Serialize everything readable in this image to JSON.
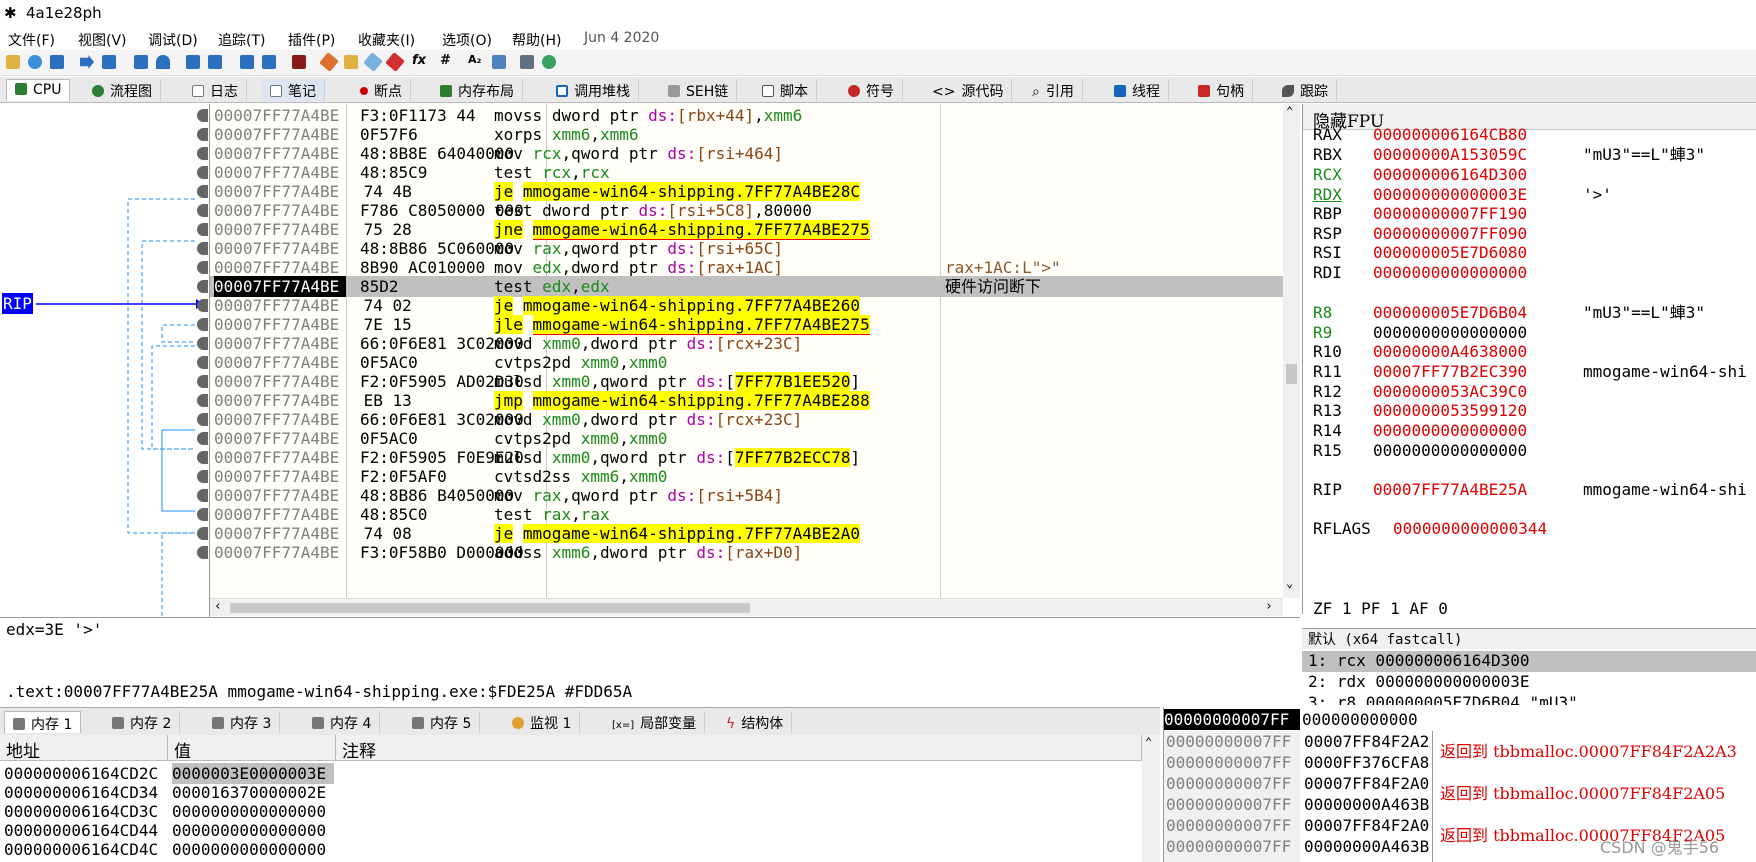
{
  "window": {
    "title": "4a1e28ph"
  },
  "menu": [
    {
      "label": "文件(F)"
    },
    {
      "label": "视图(V)"
    },
    {
      "label": "调试(D)"
    },
    {
      "label": "追踪(T)"
    },
    {
      "label": "插件(P)"
    },
    {
      "label": "收藏夹(I)"
    },
    {
      "label": "选项(O)"
    },
    {
      "label": "帮助(H)"
    },
    {
      "label": "Jun 4 2020"
    }
  ],
  "toolbar": {
    "fx": "fx",
    "hash": "#",
    "az": "A₂"
  },
  "tabs": [
    {
      "label": "CPU",
      "icon": "cpu-icon",
      "color": "#2e7d32"
    },
    {
      "label": "流程图",
      "icon": "graph-icon",
      "color": "#2e7d32"
    },
    {
      "label": "日志",
      "icon": "log-icon",
      "color": "#777777"
    },
    {
      "label": "笔记",
      "icon": "notes-icon",
      "color": "#777777"
    },
    {
      "label": "断点",
      "icon": "breakpoint-icon",
      "color": "#d00000"
    },
    {
      "label": "内存布局",
      "icon": "memory-map-icon",
      "color": "#2e7d32"
    },
    {
      "label": "调用堆栈",
      "icon": "call-stack-icon",
      "color": "#1565c0"
    },
    {
      "label": "SEH链",
      "icon": "seh-icon",
      "color": "#555555"
    },
    {
      "label": "脚本",
      "icon": "script-icon",
      "color": "#555555"
    },
    {
      "label": "符号",
      "icon": "symbols-icon",
      "color": "#c62828"
    },
    {
      "label": "源代码",
      "icon": "source-icon",
      "color": "#555555"
    },
    {
      "label": "引用",
      "icon": "references-icon",
      "color": "#555555"
    },
    {
      "label": "线程",
      "icon": "threads-icon",
      "color": "#1565c0"
    },
    {
      "label": "句柄",
      "icon": "handles-icon",
      "color": "#c62828"
    },
    {
      "label": "跟踪",
      "icon": "trace-icon",
      "color": "#555555"
    }
  ],
  "disasm": {
    "rip_label": "RIP",
    "rows": [
      {
        "addr": "00007FF77A4BE",
        "bytes": "F3:0F1173 44",
        "mn": "movss",
        "ops": [
          [
            "dword ptr ",
            ""
          ],
          [
            "ds:",
            "kw"
          ],
          [
            "[rbx+44]",
            "num"
          ],
          [
            ",",
            ""
          ],
          [
            "xmm6",
            "reg"
          ]
        ],
        "jump": false,
        "ul": false,
        "arrow": "",
        "comment": "",
        "rip": false
      },
      {
        "addr": "00007FF77A4BE",
        "bytes": "0F57F6",
        "mn": "xorps",
        "ops": [
          [
            "xmm6",
            "reg"
          ],
          [
            ",",
            ""
          ],
          [
            "xmm6",
            "reg"
          ]
        ],
        "jump": false,
        "ul": false,
        "arrow": "",
        "comment": "",
        "rip": false
      },
      {
        "addr": "00007FF77A4BE",
        "bytes": "48:8B8E 64040000",
        "mn": "mov",
        "ops": [
          [
            "rcx",
            "reg"
          ],
          [
            ",qword ptr ",
            ""
          ],
          [
            "ds:",
            "kw"
          ],
          [
            "[rsi+464]",
            "num"
          ]
        ],
        "jump": false,
        "ul": false,
        "arrow": "",
        "comment": "",
        "rip": false
      },
      {
        "addr": "00007FF77A4BE",
        "bytes": "48:85C9",
        "mn": "test",
        "ops": [
          [
            "rcx",
            "reg"
          ],
          [
            ",",
            ""
          ],
          [
            "rcx",
            "reg"
          ]
        ],
        "jump": false,
        "ul": false,
        "arrow": "",
        "comment": "",
        "rip": false
      },
      {
        "addr": "00007FF77A4BE",
        "bytes": "74 4B",
        "mn": "je",
        "ops": [
          [
            "mmogame-win64-shipping.7FF77A4BE28C",
            ""
          ]
        ],
        "jump": true,
        "ul": false,
        "arrow": "⌄",
        "comment": "",
        "rip": false
      },
      {
        "addr": "00007FF77A4BE",
        "bytes": "F786 C8050000 000",
        "mn": "test",
        "ops": [
          [
            "dword ptr ",
            ""
          ],
          [
            "ds:",
            "kw"
          ],
          [
            "[rsi+5C8]",
            "num"
          ],
          [
            ",80000",
            ""
          ]
        ],
        "jump": false,
        "ul": false,
        "arrow": "",
        "comment": "",
        "rip": false
      },
      {
        "addr": "00007FF77A4BE",
        "bytes": "75 28",
        "mn": "jne",
        "ops": [
          [
            "mmogame-win64-shipping.7FF77A4BE275",
            ""
          ]
        ],
        "jump": true,
        "ul": true,
        "arrow": "⌄",
        "comment": "",
        "rip": false
      },
      {
        "addr": "00007FF77A4BE",
        "bytes": "48:8B86 5C060000",
        "mn": "mov",
        "ops": [
          [
            "rax",
            "reg"
          ],
          [
            ",qword ptr ",
            ""
          ],
          [
            "ds:",
            "kw"
          ],
          [
            "[rsi+65C]",
            "num"
          ]
        ],
        "jump": false,
        "ul": false,
        "arrow": "",
        "comment": "",
        "rip": false
      },
      {
        "addr": "00007FF77A4BE",
        "bytes": "8B90 AC010000",
        "mn": "mov",
        "ops": [
          [
            "edx",
            "reg"
          ],
          [
            ",dword ptr ",
            ""
          ],
          [
            "ds:",
            "kw"
          ],
          [
            "[rax+1AC]",
            "num"
          ]
        ],
        "jump": false,
        "ul": false,
        "arrow": "",
        "comment": "rax+1AC:L\">\"",
        "rip": false
      },
      {
        "addr": "00007FF77A4BE",
        "bytes": "85D2",
        "mn": "test",
        "ops": [
          [
            "edx",
            "reg"
          ],
          [
            ",",
            ""
          ],
          [
            "edx",
            "reg"
          ]
        ],
        "jump": false,
        "ul": false,
        "arrow": "",
        "comment": "硬件访问断下",
        "rip": true
      },
      {
        "addr": "00007FF77A4BE",
        "bytes": "74 02",
        "mn": "je",
        "ops": [
          [
            "mmogame-win64-shipping.7FF77A4BE260",
            ""
          ]
        ],
        "jump": true,
        "ul": false,
        "arrow": "⌄",
        "comment": "",
        "rip": false
      },
      {
        "addr": "00007FF77A4BE",
        "bytes": "7E 15",
        "mn": "jle",
        "ops": [
          [
            "mmogame-win64-shipping.7FF77A4BE275",
            ""
          ]
        ],
        "jump": true,
        "ul": true,
        "arrow": "⌄",
        "comment": "",
        "rip": false
      },
      {
        "addr": "00007FF77A4BE",
        "bytes": "66:0F6E81 3C02000",
        "mn": "movd",
        "ops": [
          [
            "xmm0",
            "reg"
          ],
          [
            ",dword ptr ",
            ""
          ],
          [
            "ds:",
            "kw"
          ],
          [
            "[rcx+23C]",
            "num"
          ]
        ],
        "jump": false,
        "ul": false,
        "arrow": "",
        "comment": "",
        "rip": false
      },
      {
        "addr": "00007FF77A4BE",
        "bytes": "0F5AC0",
        "mn": "cvtps2pd",
        "ops": [
          [
            "xmm0",
            "reg"
          ],
          [
            ",",
            ""
          ],
          [
            "xmm0",
            "reg"
          ]
        ],
        "jump": false,
        "ul": false,
        "arrow": "",
        "comment": "",
        "rip": false
      },
      {
        "addr": "00007FF77A4BE",
        "bytes": "F2:0F5905 AD02D30",
        "mn": "mulsd",
        "ops": [
          [
            "xmm0",
            "reg"
          ],
          [
            ",qword ptr ",
            ""
          ],
          [
            "ds:",
            "kw"
          ],
          [
            "[",
            ""
          ],
          [
            "7FF77B1EE520",
            "jmpinline"
          ],
          [
            "]",
            ""
          ]
        ],
        "jump": false,
        "ul": false,
        "arrow": "",
        "comment": "",
        "rip": false
      },
      {
        "addr": "00007FF77A4BE",
        "bytes": "EB 13",
        "mn": "jmp",
        "ops": [
          [
            "mmogame-win64-shipping.7FF77A4BE288",
            ""
          ]
        ],
        "jump": true,
        "ul": false,
        "arrow": "⌄",
        "comment": "",
        "rip": false
      },
      {
        "addr": "00007FF77A4BE",
        "bytes": "66:0F6E81 3C02000",
        "mn": "movd",
        "ops": [
          [
            "xmm0",
            "reg"
          ],
          [
            ",dword ptr ",
            ""
          ],
          [
            "ds:",
            "kw"
          ],
          [
            "[rcx+23C]",
            "num"
          ]
        ],
        "jump": false,
        "ul": false,
        "arrow": "",
        "comment": "",
        "rip": false
      },
      {
        "addr": "00007FF77A4BE",
        "bytes": "0F5AC0",
        "mn": "cvtps2pd",
        "ops": [
          [
            "xmm0",
            "reg"
          ],
          [
            ",",
            ""
          ],
          [
            "xmm0",
            "reg"
          ]
        ],
        "jump": false,
        "ul": false,
        "arrow": "",
        "comment": "",
        "rip": false
      },
      {
        "addr": "00007FF77A4BE",
        "bytes": "F2:0F5905 F0E9E20",
        "mn": "mulsd",
        "ops": [
          [
            "xmm0",
            "reg"
          ],
          [
            ",qword ptr ",
            ""
          ],
          [
            "ds:",
            "kw"
          ],
          [
            "[",
            ""
          ],
          [
            "7FF77B2ECC78",
            "jmpinline"
          ],
          [
            "]",
            ""
          ]
        ],
        "jump": false,
        "ul": false,
        "arrow": "",
        "comment": "",
        "rip": false
      },
      {
        "addr": "00007FF77A4BE",
        "bytes": "F2:0F5AF0",
        "mn": "cvtsd2ss",
        "ops": [
          [
            "xmm6",
            "reg"
          ],
          [
            ",",
            ""
          ],
          [
            "xmm0",
            "reg"
          ]
        ],
        "jump": false,
        "ul": false,
        "arrow": "",
        "comment": "",
        "rip": false
      },
      {
        "addr": "00007FF77A4BE",
        "bytes": "48:8B86 B4050000",
        "mn": "mov",
        "ops": [
          [
            "rax",
            "reg"
          ],
          [
            ",qword ptr ",
            ""
          ],
          [
            "ds:",
            "kw"
          ],
          [
            "[rsi+5B4]",
            "num"
          ]
        ],
        "jump": false,
        "ul": false,
        "arrow": "",
        "comment": "",
        "rip": false
      },
      {
        "addr": "00007FF77A4BE",
        "bytes": "48:85C0",
        "mn": "test",
        "ops": [
          [
            "rax",
            "reg"
          ],
          [
            ",",
            ""
          ],
          [
            "rax",
            "reg"
          ]
        ],
        "jump": false,
        "ul": false,
        "arrow": "",
        "comment": "",
        "rip": false
      },
      {
        "addr": "00007FF77A4BE",
        "bytes": "74 08",
        "mn": "je",
        "ops": [
          [
            "mmogame-win64-shipping.7FF77A4BE2A0",
            ""
          ]
        ],
        "jump": true,
        "ul": false,
        "arrow": "⌄",
        "comment": "",
        "rip": false
      },
      {
        "addr": "00007FF77A4BE",
        "bytes": "F3:0F58B0 D000000",
        "mn": "addss",
        "ops": [
          [
            "xmm6",
            "reg"
          ],
          [
            ",dword ptr ",
            ""
          ],
          [
            "ds:",
            "kw"
          ],
          [
            "[rax+D0]",
            "num"
          ]
        ],
        "jump": false,
        "ul": false,
        "arrow": "",
        "comment": "",
        "rip": false
      }
    ]
  },
  "registers": {
    "header": "隐藏FPU",
    "rows": [
      {
        "name": "RAX",
        "value": "000000006164CB80",
        "comment": "",
        "nameColor": "#000000",
        "valColor": "#e00000"
      },
      {
        "name": "RBX",
        "value": "00000000A153059C",
        "comment": "\"mU3\"==L\"蛼3\"",
        "nameColor": "#000000",
        "valColor": "#e00000"
      },
      {
        "name": "RCX",
        "value": "000000006164D300",
        "comment": "",
        "nameColor": "#1a8a1a",
        "valColor": "#e00000"
      },
      {
        "name": "RDX",
        "value": "000000000000003E",
        "comment": "'>'",
        "nameColor": "#1a8a1a",
        "valColor": "#e00000"
      },
      {
        "name": "RBP",
        "value": "00000000007FF190",
        "comment": "",
        "nameColor": "#000000",
        "valColor": "#e00000"
      },
      {
        "name": "RSP",
        "value": "00000000007FF090",
        "comment": "",
        "nameColor": "#000000",
        "valColor": "#e00000"
      },
      {
        "name": "RSI",
        "value": "000000005E7D6080",
        "comment": "",
        "nameColor": "#000000",
        "valColor": "#e00000"
      },
      {
        "name": "RDI",
        "value": "0000000000000000",
        "comment": "",
        "nameColor": "#000000",
        "valColor": "#e00000"
      },
      {
        "name": "R8",
        "value": "000000005E7D6B04",
        "comment": "\"mU3\"==L\"蛼3\"",
        "nameColor": "#1a8a1a",
        "valColor": "#e00000"
      },
      {
        "name": "R9",
        "value": "0000000000000000",
        "comment": "",
        "nameColor": "#1a8a1a",
        "valColor": "#000000"
      },
      {
        "name": "R10",
        "value": "00000000A4638000",
        "comment": "",
        "nameColor": "#000000",
        "valColor": "#e00000"
      },
      {
        "name": "R11",
        "value": "00007FF77B2EC390",
        "comment": "mmogame-win64-shi",
        "nameColor": "#000000",
        "valColor": "#e00000"
      },
      {
        "name": "R12",
        "value": "0000000053AC39C0",
        "comment": "",
        "nameColor": "#000000",
        "valColor": "#e00000"
      },
      {
        "name": "R13",
        "value": "0000000053599120",
        "comment": "",
        "nameColor": "#000000",
        "valColor": "#e00000"
      },
      {
        "name": "R14",
        "value": "0000000000000000",
        "comment": "",
        "nameColor": "#000000",
        "valColor": "#e00000"
      },
      {
        "name": "R15",
        "value": "0000000000000000",
        "comment": "",
        "nameColor": "#000000",
        "valColor": "#000000"
      },
      {
        "name": "RIP",
        "value": "00007FF77A4BE25A",
        "comment": "mmogame-win64-shi",
        "nameColor": "#000000",
        "valColor": "#e00000"
      },
      {
        "name": "RFLAGS",
        "value": "0000000000000344",
        "comment": "",
        "nameColor": "#000000",
        "valColor": "#e00000"
      }
    ],
    "flags": "ZF 1  PF 1  AF 0"
  },
  "info": {
    "line1": "edx=3E '>'",
    "line2": ".text:00007FF77A4BE25A mmogame-win64-shipping.exe:$FDE25A #FDD65A"
  },
  "args": {
    "header": "默认 (x64 fastcall)",
    "rows": [
      "1: rcx 000000006164D300",
      "2: rdx 000000000000003E",
      "3: r8 000000005E7D6B04 \"mU3\""
    ]
  },
  "memtabs": [
    {
      "label": "内存 1",
      "icon": "memory-icon"
    },
    {
      "label": "内存 2",
      "icon": "memory-icon"
    },
    {
      "label": "内存 3",
      "icon": "memory-icon"
    },
    {
      "label": "内存 4",
      "icon": "memory-icon"
    },
    {
      "label": "内存 5",
      "icon": "memory-icon"
    },
    {
      "label": "监视 1",
      "icon": "watch-icon"
    },
    {
      "label": "局部变量",
      "icon": "locals-icon",
      "prefix": "[x=]"
    },
    {
      "label": "结构体",
      "icon": "struct-icon"
    }
  ],
  "dump": {
    "headers": [
      "地址",
      "值",
      "注释"
    ],
    "rows": [
      [
        "000000006164CD2C",
        "0000003E0000003E"
      ],
      [
        "000000006164CD34",
        "000016370000002E"
      ],
      [
        "000000006164CD3C",
        "0000000000000000"
      ],
      [
        "000000006164CD44",
        "0000000000000000"
      ],
      [
        "000000006164CD4C",
        "0000000000000000"
      ]
    ]
  },
  "stack": {
    "top": "00000000007FF",
    "topval": "000000000000",
    "rows": [
      {
        "addr": "00000000007FF",
        "val": "00007FF84F2A2A",
        "cmt": "返回到 tbbmalloc.00007FF84F2A2A3"
      },
      {
        "addr": "00000000007FF",
        "val": "0000FF376CFA8",
        "cmt": ""
      },
      {
        "addr": "00000000007FF",
        "val": "00007FF84F2A0",
        "cmt": "返回到 tbbmalloc.00007FF84F2A05"
      },
      {
        "addr": "00000000007FF",
        "val": "00000000A463B",
        "cmt": ""
      },
      {
        "addr": "00000000007FF",
        "val": "00007FF84F2A0",
        "cmt": "返回到 tbbmalloc.00007FF84F2A05"
      },
      {
        "addr": "00000000007FF",
        "val": "00000000A463B",
        "cmt": ""
      }
    ]
  },
  "watermark": "CSDN @鬼手56"
}
